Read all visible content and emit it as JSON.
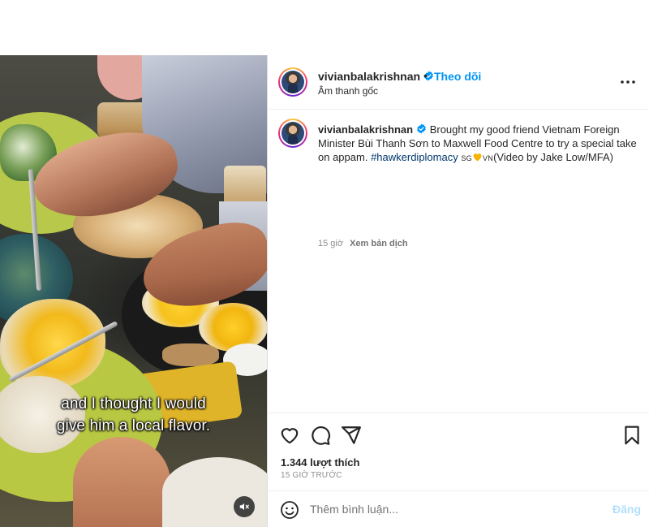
{
  "video": {
    "subtitle_line1": "and I thought I would",
    "subtitle_line2": "give him a local flavor.",
    "mute_icon": "speaker-muted-icon"
  },
  "post": {
    "author": "vivianbalakrishnan",
    "verified": true,
    "follow_label": "Theo dõi",
    "separator": "•",
    "audio_label": "Âm thanh gốc",
    "more_icon": "more-options-icon"
  },
  "caption": {
    "username": "vivianbalakrishnan",
    "text": "Brought my good friend Vietnam Foreign Minister Bùi Thanh Sơn to Maxwell Food Centre to try a special take on appam.",
    "hashtag": "#hawkerdiplomacy",
    "flag_sg": "SG",
    "flag_vn": "VN",
    "suffix": "(Video by Jake Low/MFA)",
    "time": "15 giờ",
    "translate_label": "Xem bản dịch"
  },
  "actions": {
    "like_icon": "heart-icon",
    "comment_icon": "comment-icon",
    "share_icon": "share-icon",
    "save_icon": "bookmark-icon",
    "likes_text": "1.344 lượt thích",
    "time_ago": "15 GIỜ TRƯỚC"
  },
  "comment": {
    "emoji_icon": "emoji-icon",
    "placeholder": "Thêm bình luận...",
    "post_label": "Đăng"
  },
  "colors": {
    "accent": "#0095f6",
    "hashtag": "#00376b",
    "muted_text": "#8e8e8e",
    "post_disabled": "#b2dffc",
    "verified": "#0095f6"
  }
}
